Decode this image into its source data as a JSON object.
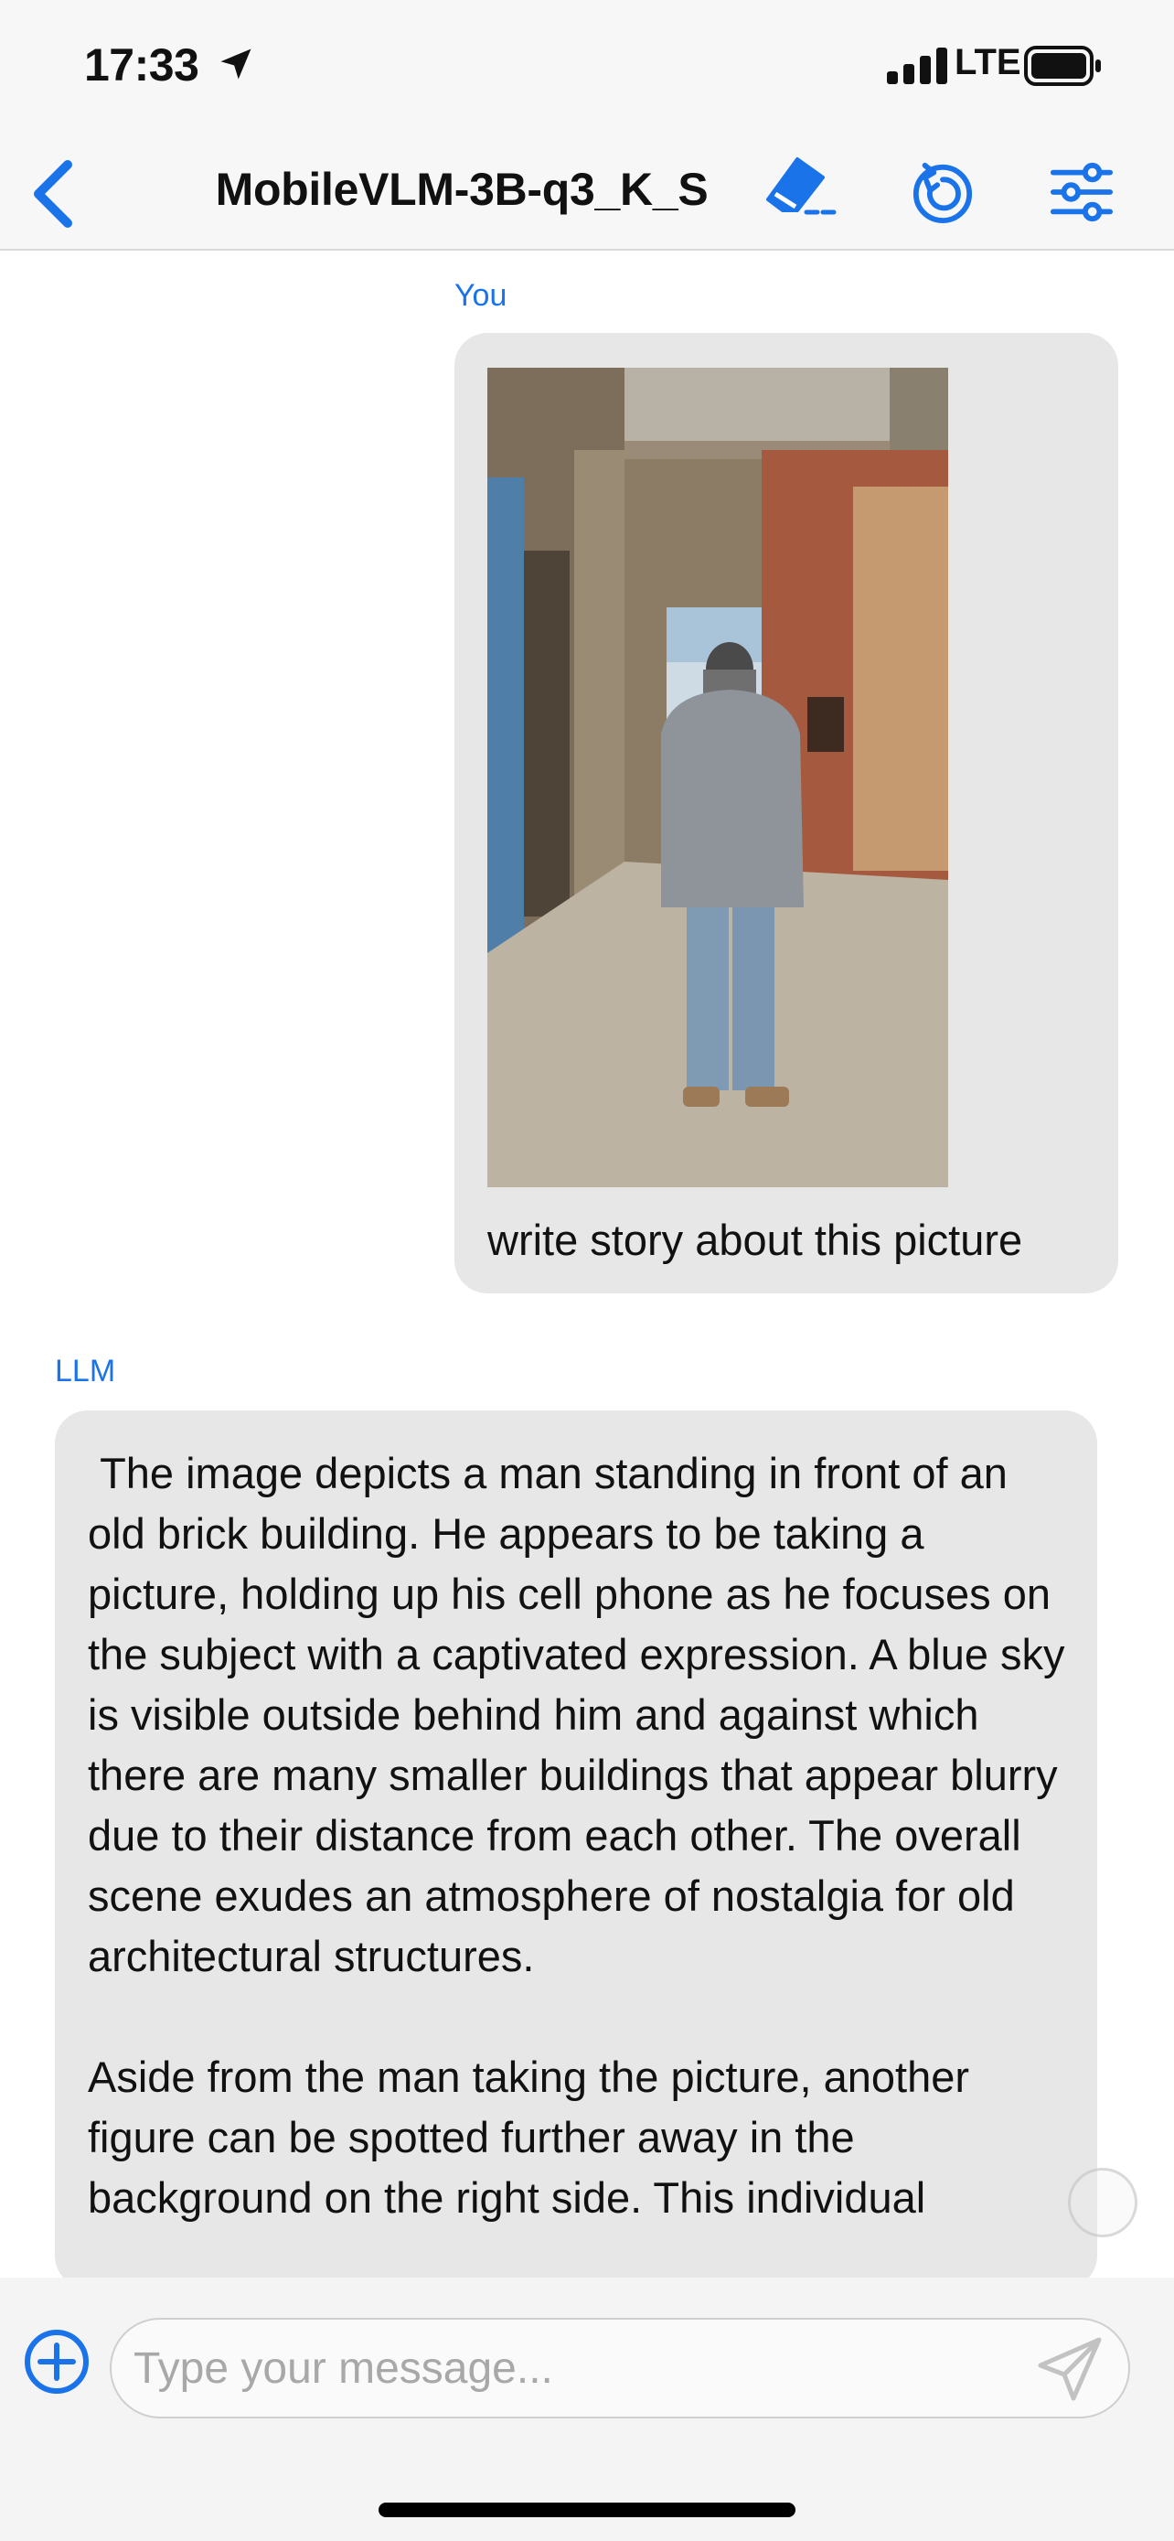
{
  "status_bar": {
    "time": "17:33",
    "network": "LTE",
    "icons": [
      "location-arrow-icon",
      "signal-icon",
      "battery-icon"
    ]
  },
  "nav": {
    "title": "MobileVLM-3B-q3_K_S",
    "icons": [
      "back-chevron-icon",
      "eraser-icon",
      "reload-icon",
      "settings-sliders-icon"
    ]
  },
  "conversation": {
    "user": {
      "sender": "You",
      "text": "write story about this picture"
    },
    "assistant": {
      "sender": "LLM",
      "text": " The image depicts a man standing in front of an old brick building. He appears to be taking a picture, holding up his cell phone as he focuses on the subject with a captivated expression. A blue sky is visible outside behind him and against which there are many smaller buildings that appear blurry due to their distance from each other. The overall scene exudes an atmosphere of nostalgia for old architectural structures.\n\nAside from the man taking the picture, another figure can be spotted further away in the background on the right side. This individual"
    }
  },
  "composer": {
    "placeholder": "Type your message...",
    "icons": [
      "add-circle-icon",
      "send-icon"
    ]
  },
  "colors": {
    "accent": "#1a73e8",
    "bubble": "#e7e7e7",
    "bar_background": "#f7f7f7"
  }
}
